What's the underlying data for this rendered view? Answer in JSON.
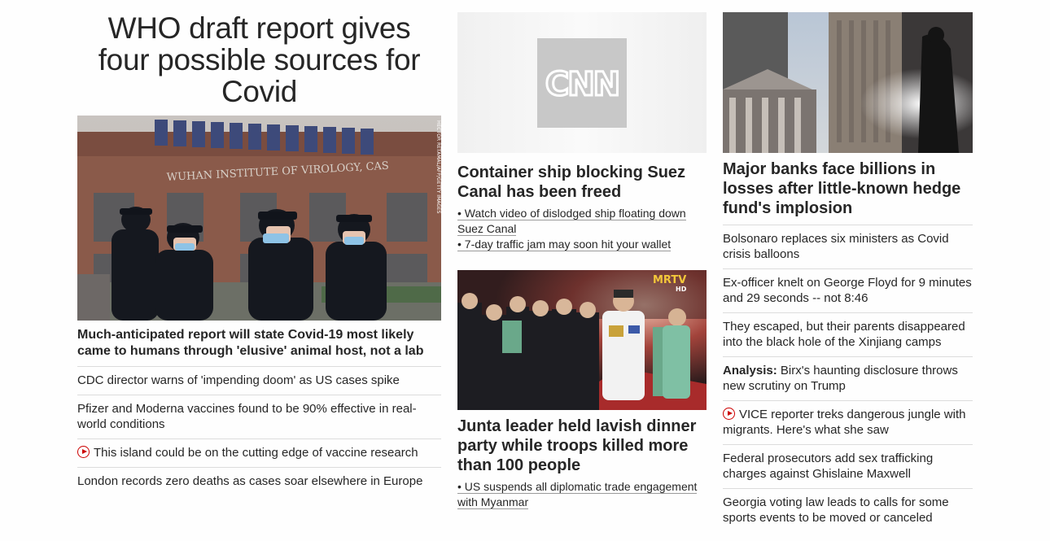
{
  "lead": {
    "headline": "WHO draft report gives four possible sources for Covid",
    "image_credit": "HECTOR RETAMAL/AFP/GETTY IMAGES",
    "image_sign_text": "WUHAN INSTITUTE OF VIROLOGY, CAS",
    "subheadline": "Much-anticipated report will state Covid-19 most likely came to humans through 'elusive' animal host, not a lab",
    "stories": [
      {
        "text": "CDC director warns of 'impending doom' as US cases spike",
        "video": false
      },
      {
        "text": "Pfizer and Moderna vaccines found to be 90% effective in real-world conditions",
        "video": false
      },
      {
        "text": "This island could be on the cutting edge of vaccine research",
        "video": true
      },
      {
        "text": "London records zero deaths as cases soar elsewhere in Europe",
        "video": false
      }
    ]
  },
  "middle": {
    "story1": {
      "logo_text": "CNN",
      "headline": "Container ship blocking Suez Canal has been freed",
      "links": [
        "• Watch video of dislodged ship floating down Suez Canal",
        "• 7-day traffic jam may soon hit your wallet"
      ]
    },
    "story2": {
      "image_badge": "MRTV",
      "image_badge_sub": "HD",
      "headline": "Junta leader held lavish dinner party while troops killed more than 100 people",
      "links": [
        "• US suspends all diplomatic trade engagement with Myanmar"
      ]
    }
  },
  "right": {
    "headline": "Major banks face billions in losses after little-known hedge fund's implosion",
    "stories": [
      {
        "label": "",
        "text": "Bolsonaro replaces six ministers as Covid crisis balloons",
        "video": false
      },
      {
        "label": "",
        "text": "Ex-officer knelt on George Floyd for 9 minutes and 29 seconds -- not 8:46",
        "video": false
      },
      {
        "label": "",
        "text": "They escaped, but their parents disappeared into the black hole of the Xinjiang camps",
        "video": false
      },
      {
        "label": "Analysis:",
        "text": " Birx's haunting disclosure throws new scrutiny on Trump",
        "video": false
      },
      {
        "label": "",
        "text": "VICE reporter treks dangerous jungle with migrants. Here's what she saw",
        "video": true
      },
      {
        "label": "",
        "text": "Federal prosecutors add sex trafficking charges against Ghislaine Maxwell",
        "video": false
      },
      {
        "label": "",
        "text": "Georgia voting law leads to calls for some sports events to be moved or canceled",
        "video": false
      }
    ]
  },
  "colors": {
    "video_icon": "#cc0000",
    "divider": "#dcdcdc",
    "text": "#262626"
  }
}
